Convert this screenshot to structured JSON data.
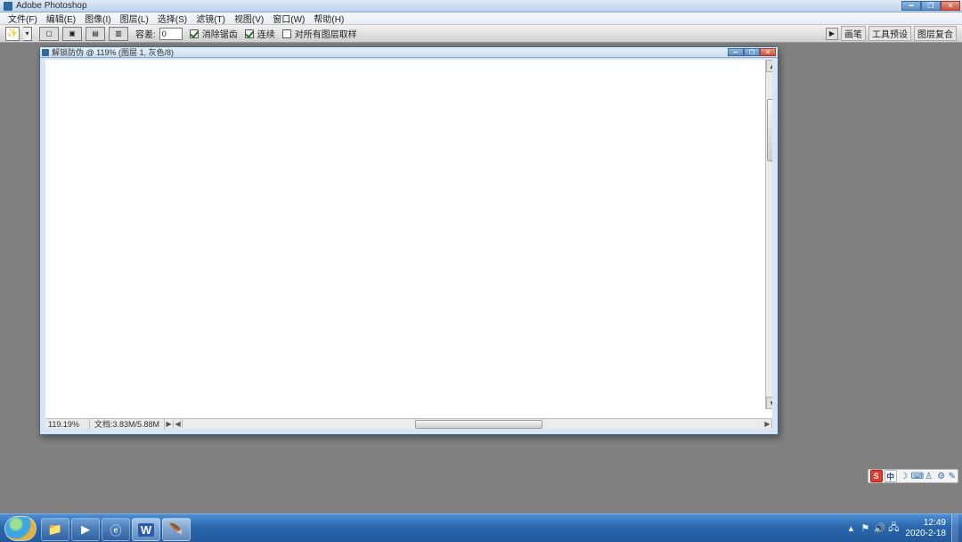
{
  "app": {
    "title": "Adobe Photoshop"
  },
  "menu": {
    "items": [
      "文件(F)",
      "编辑(E)",
      "图像(I)",
      "图层(L)",
      "选择(S)",
      "滤镜(T)",
      "视图(V)",
      "窗口(W)",
      "帮助(H)"
    ]
  },
  "options": {
    "tolerance_label": "容差:",
    "tolerance_value": "0",
    "anti_alias_label": "消除锯齿",
    "anti_alias_checked": true,
    "contiguous_label": "连续",
    "contiguous_checked": true,
    "all_layers_label": "对所有图层取样",
    "all_layers_checked": false,
    "palette_labels": [
      "画笔",
      "工具预设",
      "图层复合"
    ]
  },
  "document": {
    "title": "解锁防伪 @ 119% (图层 1, 灰色/8)",
    "zoom": "119.19%",
    "info": "文档:3.83M/5.88M"
  },
  "ime": {
    "badge": "S",
    "lang": "中"
  },
  "tray": {
    "time": "12:49",
    "date": "2020-2-18"
  }
}
